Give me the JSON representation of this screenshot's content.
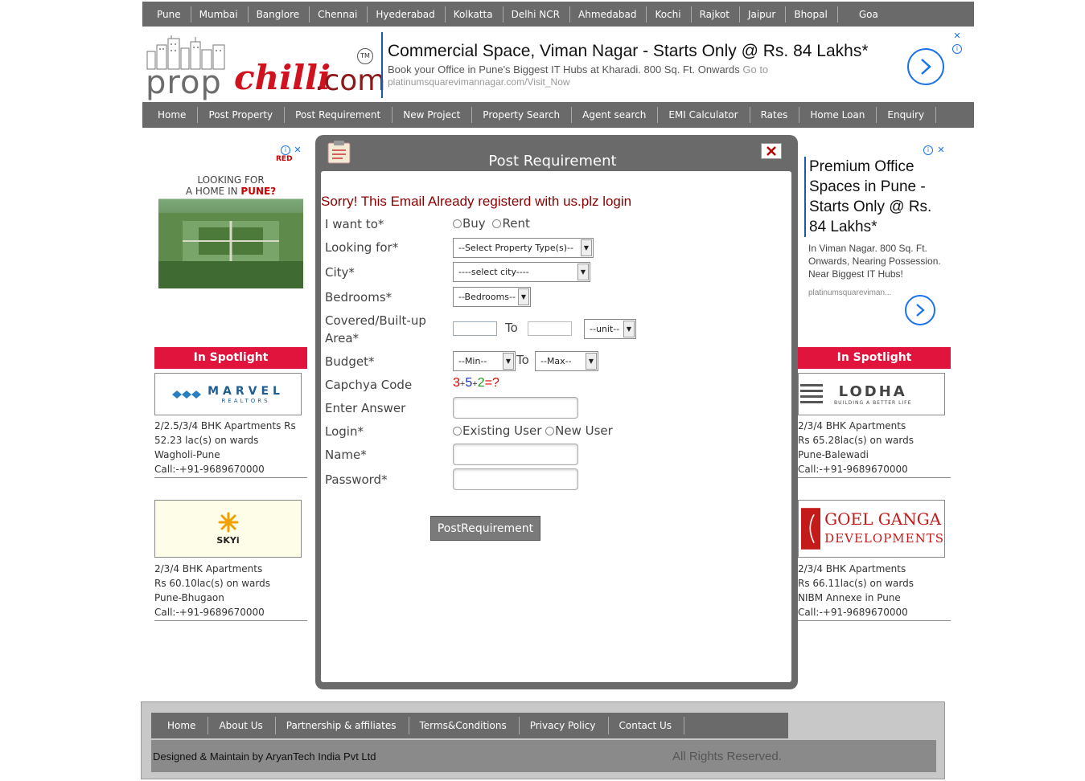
{
  "city_nav": [
    "Pune",
    "Mumbai",
    "Banglore",
    "Chennai",
    "Hyederabad",
    "Kolkatta",
    "Delhi NCR",
    "Ahmedabad",
    "Kochi",
    "Rajkot",
    "Jaipur",
    "Bhopal",
    "Goa"
  ],
  "logo": {
    "prop": "prop",
    "chilli": "chilli",
    "com": ".com",
    "tm": "TM"
  },
  "top_ad": {
    "headline": "Commercial Space, Viman Nagar - Starts Only @ Rs. 84 Lakhs*",
    "desc": "Book your Office in Pune's Biggest IT Hubs at Kharadi. 800 Sq. Ft. Onwards",
    "goto": "Go to",
    "url": "platinumsquarevimannagar.com/Visit_Now"
  },
  "main_nav": [
    "Home",
    "Post Property",
    "Post Requirement",
    "New Project",
    "Property Search",
    "Agent search",
    "EMI Calculator",
    "Rates",
    "Home Loan",
    "Enquiry"
  ],
  "left_ad": {
    "line1": "LOOKING FOR",
    "line2": "A HOME IN",
    "city": "PUNE?",
    "brand": "RED"
  },
  "right_ad": {
    "headline": "Premium Office Spaces in Pune - Starts Only @ Rs. 84 Lakhs*",
    "desc": "In Viman Nagar. 800 Sq. Ft. Onwards, Nearing Possession. Near Biggest IT Hubs!",
    "url": "platinumsquareviman..."
  },
  "spotlight_title": "In Spotlight",
  "spotlight_left": [
    {
      "brand": "MARVEL",
      "sub": "REALTORS",
      "l1": "2/2.5/3/4 BHK Apartments Rs",
      "l2": "52.23 lac(s) on wards",
      "l3": "Wagholi-Pune",
      "l4": "Call:-+91-9689670000"
    },
    {
      "brand": "SKYi",
      "l1": "2/3/4 BHK Apartments",
      "l2": "Rs 60.10lac(s) on wards",
      "l3": "Pune-Bhugaon",
      "l4": "Call:-+91-9689670000"
    }
  ],
  "spotlight_right": [
    {
      "brand": "LODHA",
      "sub": "BUILDING A BETTER LIFE",
      "l1": "2/3/4 BHK Apartments",
      "l2": "Rs 65.28lac(s) on wards",
      "l3": "Pune-Balewadi",
      "l4": "Call:-+91-9689670000"
    },
    {
      "brand": "GOEL GANGA",
      "sub": "DEVELOPMENTS",
      "l1": "2/3/4 BHK Apartments",
      "l2": "Rs 66.11lac(s) on wards",
      "l3": "NIBM Annexe in Pune",
      "l4": "Call:-+91-9689670000"
    }
  ],
  "modal": {
    "title": "Post Requirement",
    "error": "Sorry! This Email Already registerd with us.plz login",
    "labels": {
      "want": "I want to*",
      "looking": "Looking for*",
      "city": "City*",
      "bedrooms": "Bedrooms*",
      "area1": "Covered/Built-up",
      "area2": "Area*",
      "budget": "Budget*",
      "captcha": "Capchya Code",
      "answer": "Enter Answer",
      "login": "Login*",
      "name": "Name*",
      "password": "Password*"
    },
    "want_options": [
      "Buy",
      "Rent"
    ],
    "property_type": "--Select Property Type(s)--",
    "city_select": "----select city----",
    "bedrooms_select": "--Bedrooms--",
    "to_label": "To",
    "unit_select": "--unit--",
    "min_select": "--Min--",
    "max_select": "--Max--",
    "captcha": {
      "a": "3",
      "op1": "+",
      "b": "5",
      "op2": "+",
      "c": "2",
      "eq": "=?"
    },
    "login_options": [
      "Existing User",
      "New User"
    ],
    "submit": "PostRequirement"
  },
  "footer": {
    "nav": [
      "Home",
      "About Us",
      "Partnership & affiliates",
      "Terms&Conditions",
      "Privacy Policy",
      "Contact Us"
    ],
    "designed": "Designed & Maintain by AryanTech India Pvt Ltd",
    "rights": "All Rights Reserved."
  },
  "colors": {
    "nav_bg": "#6a6a6a",
    "spotlight": "#e0143c",
    "error": "#8b0000",
    "ad_blue": "#1a73e8"
  }
}
